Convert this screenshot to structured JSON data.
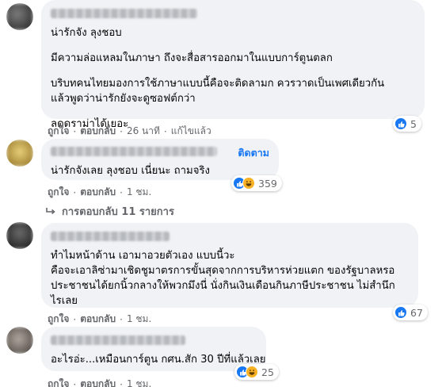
{
  "comments": [
    {
      "paragraphs": [
        [
          "น่ารักจัง ลุงชอบ"
        ],
        [
          "มีความล่อแหลมในภาษา ถึงจะสื่อสารออกมาในแบบการ์ตูนตลก"
        ],
        [
          "บริบทคนไทยมองการใช้ภาษาแบบนี้คือจะติดลามก ควรวาดเป็นเพศเดียวกัน",
          "แล้วพูดว่าน่ารักยังจะดูซอฟต์กว่า"
        ],
        [
          "ลดดราม่าได้เยอะ"
        ]
      ],
      "like_label": "ถูกใจ",
      "reply_label": "ตอบกลับ",
      "time": "26 นาที",
      "edited": "แก้ไขแล้ว",
      "reaction_count": "5"
    },
    {
      "follow_label": "ติดตาม",
      "paragraphs": [
        [
          "น่ารักจังเลย ลุงชอบ เนี่ยนะ ถามจริง"
        ]
      ],
      "like_label": "ถูกใจ",
      "reply_label": "ตอบกลับ",
      "time": "1 ชม.",
      "reaction_count": "359"
    },
    {
      "paragraphs": [
        [
          "ทำไมหน้าด้าน เอามาอวยตัวเอง แบบนี้วะ",
          "คือจะเอาลิซ่ามาเชิดชูมาตรการขั้นสุดจากการบริหารห่วยแตก ของรัฐบาลหรอ",
          "ประชาชนได้ยกนิ้วกลางให้พวกมึงนี่ นั่งกินเงินเดือนกินภาษีประชาชน ไม่สำนึก",
          "ไรเลย"
        ]
      ],
      "like_label": "ถูกใจ",
      "reply_label": "ตอบกลับ",
      "time": "1 ชม.",
      "reaction_count": "67"
    },
    {
      "paragraphs": [
        [
          "อะไรอ่ะ...เหมือนการ์ตูน กศน.สัก 30 ปีที่แล้วเลย"
        ]
      ],
      "like_label": "ถูกใจ",
      "reply_label": "ตอบกลับ",
      "time": "1 ชม.",
      "reaction_count": "25"
    }
  ],
  "replies_toggle": "การตอบกลับ 11 รายการ",
  "colors": {
    "like_blue": "#1877f2",
    "haha_yellow": "#f7b125",
    "bubble": "#f0f2f5",
    "meta_gray": "#65676b"
  },
  "icons": [
    "like-icon",
    "haha-icon",
    "reply-arrow-icon"
  ]
}
